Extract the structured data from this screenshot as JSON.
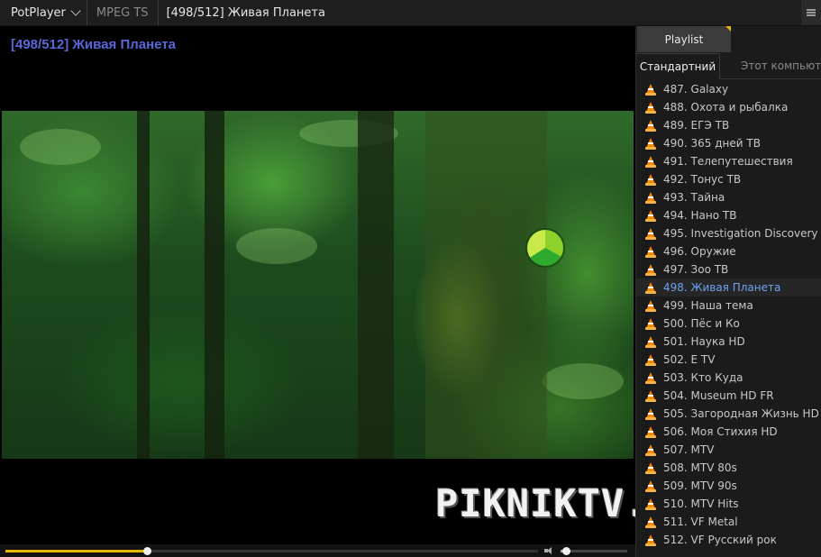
{
  "titlebar": {
    "app_name": "PotPlayer",
    "format": "MPEG TS",
    "window_title": "[498/512] Живая Планета"
  },
  "video": {
    "osd_title": "[498/512] Живая Планета",
    "watermark": "PIKNIKTV.COM",
    "seek_progress_percent": 26.5,
    "volume_percent": 8
  },
  "playlist": {
    "tab_label": "Playlist",
    "subtabs": {
      "active": "Стандартний",
      "inactive": "Этот компьютер"
    },
    "current_index": 11,
    "items": [
      "487. Galaxy",
      "488. Охота и рыбалка",
      "489. ЕГЭ ТВ",
      "490. 365 дней ТВ",
      "491. Телепутешествия",
      "492. Тонус ТВ",
      "493. Тайна",
      "494. Нано ТВ",
      "495. Investigation Discovery",
      "496. Оружие",
      "497. Зоо ТВ",
      "498. Живая Планета",
      "499. Наша тема",
      "500. Пёс и Ко",
      "501. Наука HD",
      "502. E TV",
      "503. Кто Куда",
      "504. Museum HD FR",
      "505. Загородная Жизнь HD",
      "506. Моя Стихия HD",
      "507. MTV",
      "508. MTV 80s",
      "509. MTV 90s",
      "510. MTV Hits",
      "511. VF Metal",
      "512. VF Русский рок"
    ]
  },
  "colors": {
    "osd_title": "#5a67d8",
    "current_item": "#6ea3f2",
    "seek_fill": "#e6b800",
    "cone_icon": "#f08a00"
  }
}
